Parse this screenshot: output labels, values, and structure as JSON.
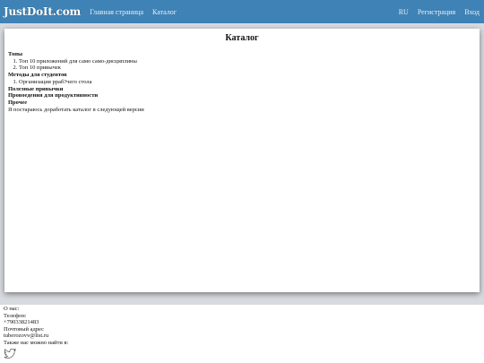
{
  "navbar": {
    "logo": "JustDoIt.com",
    "links": [
      "Главная страница",
      "Каталог"
    ],
    "lang": "RU",
    "register": "Регистрация",
    "login": "Вход"
  },
  "catalog": {
    "title": "Каталог",
    "sections": [
      {
        "title": "Топы",
        "items": [
          "Топ 10 приложений для само само-дисциплины",
          "Топ 10 привычек"
        ]
      },
      {
        "title": "Методы для студентов",
        "items": [
          "Организация рраб?чего стола"
        ]
      },
      {
        "title": "Полезные привычки",
        "items": []
      },
      {
        "title": "Провоедения для продуктивности",
        "items": []
      },
      {
        "title": "Прочее",
        "items": []
      }
    ],
    "note": "Я постараюсь доработать каталог в следующей версии"
  },
  "footer": {
    "about": "О нас:",
    "phone_label": "Телефон:",
    "phone": "+79033821483",
    "mail_label": "Почтовый адрес",
    "mail": "tuberozovv@list.ru",
    "also": "Также нас можно найти в:"
  },
  "colors": {
    "navbar": "#3f82b5",
    "page_bg": "#d7dadf"
  },
  "icons": {
    "social": "twitter-icon"
  }
}
